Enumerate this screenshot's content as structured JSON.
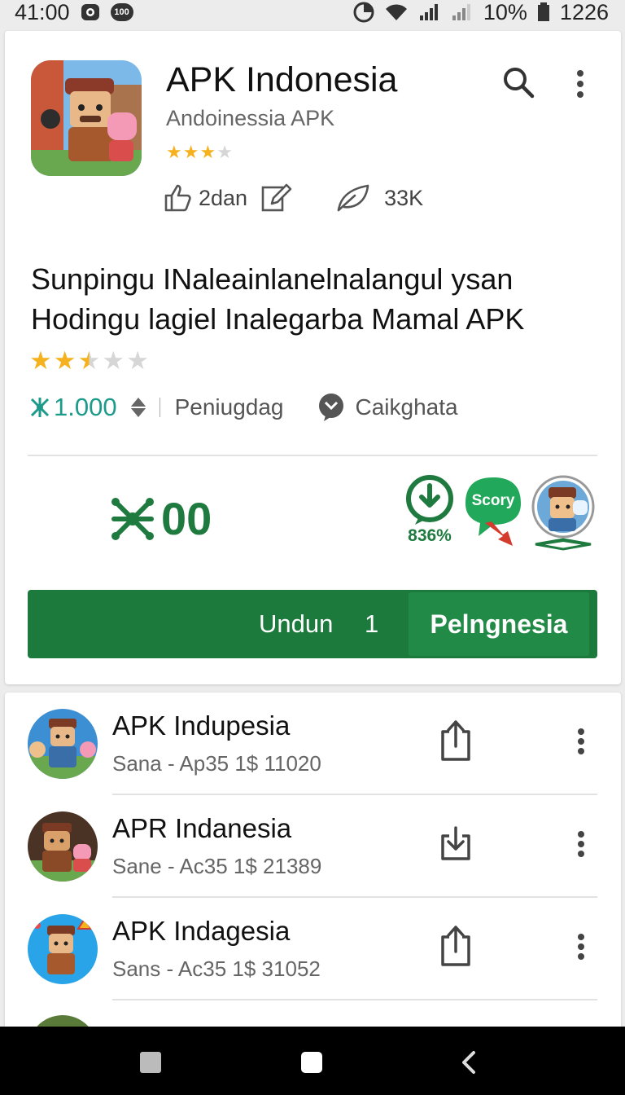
{
  "status_bar": {
    "time": "41:00",
    "bubble": "100",
    "battery": "10%",
    "clock": "1226"
  },
  "app": {
    "title": "APK Indonesia",
    "subtitle": "Andoinessia APK",
    "rating_stars": 3,
    "stats": {
      "likes": "2dan",
      "downloads": "33K"
    }
  },
  "headline": "Sunpingu INaleainlanelnalangul ysan Hodingu lagiel Inalegarba Mamal APK",
  "rating2": 2.5,
  "meta": {
    "price": "1.000",
    "category": "Peniugdag",
    "tag": "Caikghata"
  },
  "big_count": "00",
  "badges": {
    "download_percent": "836%",
    "story_label": "Scory"
  },
  "action": {
    "undun_label": "Undun",
    "undun_count": "1",
    "install_label": "Pelngnesia"
  },
  "list": [
    {
      "title": "APK Indupesia",
      "subtitle": "Sana - Ap35 1$ 11020",
      "avatar_color": "#3d8fd4"
    },
    {
      "title": "APR Indanesia",
      "subtitle": "Sane - Ac35 1$ 21389",
      "avatar_color": "#4a3224"
    },
    {
      "title": "APK Indagesia",
      "subtitle": "Sans - Ac35 1$ 31052",
      "avatar_color": "#2aa4e8"
    }
  ],
  "colors": {
    "accent_green": "#1d7a3d",
    "install_green": "#228a47",
    "price_teal": "#1c9a8a",
    "star_gold": "#f5b21e"
  },
  "icons": [
    "search-icon",
    "more-vert-icon",
    "thumb-up-icon",
    "edit-icon",
    "leaf-icon",
    "molecule-icon",
    "download-icon",
    "share-download-icon"
  ]
}
